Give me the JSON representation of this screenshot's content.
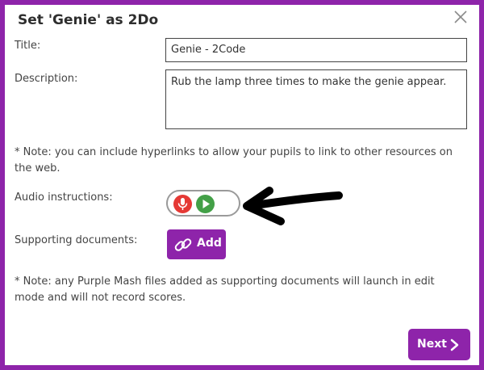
{
  "dialog": {
    "title": "Set 'Genie' as 2Do",
    "close_icon": "close-icon"
  },
  "form": {
    "title_label": "Title:",
    "title_value": "Genie - 2Code",
    "description_label": "Description:",
    "description_value": "Rub the lamp three times to make the genie appear.",
    "hyperlink_note": "* Note: you can include hyperlinks to allow your pupils to link to other resources on the web.",
    "audio_label": "Audio instructions:",
    "record_icon": "microphone-icon",
    "play_icon": "play-icon",
    "supporting_label": "Supporting documents:",
    "add_label": "Add",
    "add_icon": "link-icon",
    "files_note": "* Note: any Purple Mash files added as supporting documents will launch in edit mode and will not record scores."
  },
  "footer": {
    "next_label": "Next",
    "next_icon": "chevron-right-icon"
  },
  "annotation": {
    "arrow_icon": "hand-drawn-arrow-left"
  },
  "colors": {
    "frame": "#8e24aa",
    "button": "#8e24aa",
    "record": "#e53935",
    "play": "#43a047"
  }
}
